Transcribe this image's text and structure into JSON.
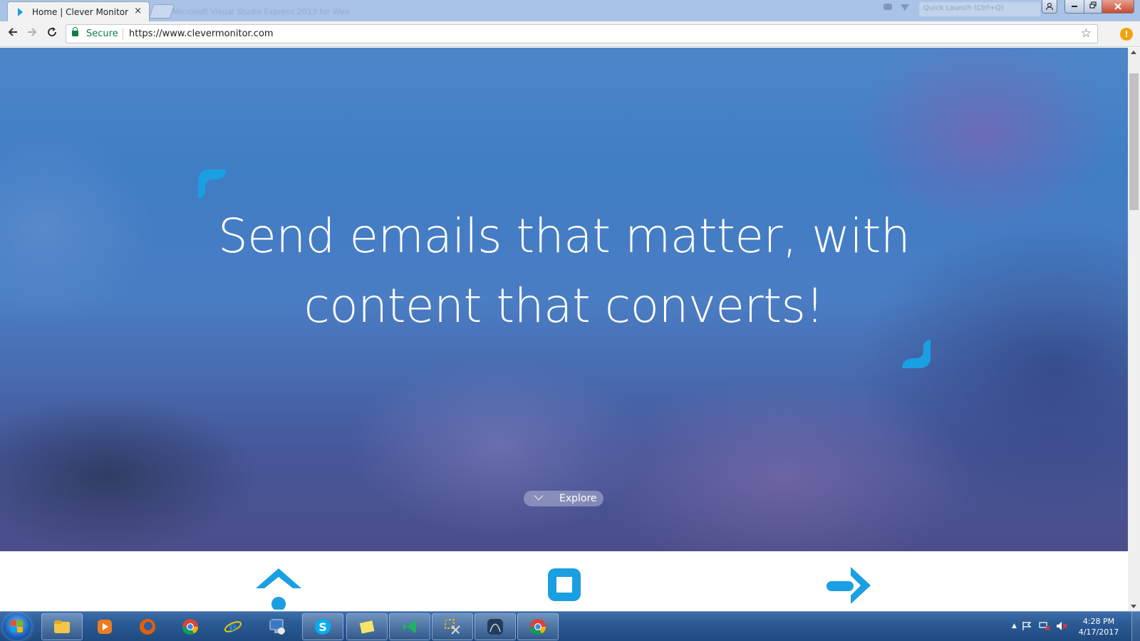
{
  "browser": {
    "active_tab_title": "Home | Clever Monitor",
    "active_tab_close": "×",
    "inactive_tab_title": "Microsoft Visual Studio Express 2013 for Web",
    "quick_launch_placeholder": "Quick Launch (Ctrl+Q)",
    "secure_label": "Secure",
    "url": "https://www.clevermonitor.com",
    "bookmark_star": "☆",
    "extension_badge": "!"
  },
  "hero": {
    "headline": "Send emails that matter, with content that converts!",
    "explore_label": "Explore",
    "accent_color": "#1a9fe3"
  },
  "features": {
    "icons": [
      "home-icon",
      "stop-square-icon",
      "arrow-right-icon"
    ]
  },
  "taskbar": {
    "pinned": [
      {
        "name": "file-explorer-icon"
      },
      {
        "name": "media-player-icon"
      },
      {
        "name": "firefox-icon"
      },
      {
        "name": "chrome-icon"
      },
      {
        "name": "internet-explorer-icon"
      },
      {
        "name": "remote-desktop-icon"
      },
      {
        "name": "skype-icon"
      },
      {
        "name": "sticky-notes-icon"
      },
      {
        "name": "visual-studio-icon"
      },
      {
        "name": "snipping-tool-icon"
      },
      {
        "name": "sql-server-icon"
      },
      {
        "name": "chrome-active-icon"
      }
    ],
    "tray_expand": "▲",
    "time": "4:28 PM",
    "date": "4/17/2017"
  },
  "colors": {
    "taskbar": "#2b5b95",
    "secure_green": "#0b8043",
    "accent_blue": "#1a9fe3"
  }
}
